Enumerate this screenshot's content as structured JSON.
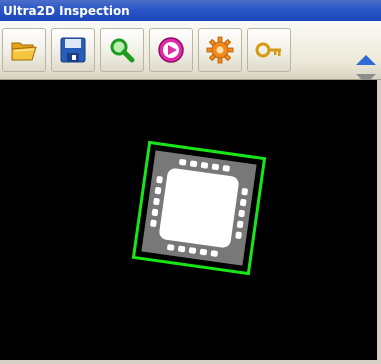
{
  "window": {
    "title": "Ultra2D Inspection"
  },
  "toolbar": {
    "buttons": [
      {
        "icon": "folder-open-icon"
      },
      {
        "icon": "floppy-disk-icon"
      },
      {
        "icon": "magnifier-icon"
      },
      {
        "icon": "play-icon"
      },
      {
        "icon": "gear-icon"
      },
      {
        "icon": "key-icon"
      }
    ],
    "scroll": {
      "up_icon": "triangle-up-icon",
      "down_icon": "triangle-down-icon"
    }
  },
  "viewport": {
    "background": "#000000",
    "detection_box_color": "#19e619",
    "object": "qfn-chip-image"
  }
}
